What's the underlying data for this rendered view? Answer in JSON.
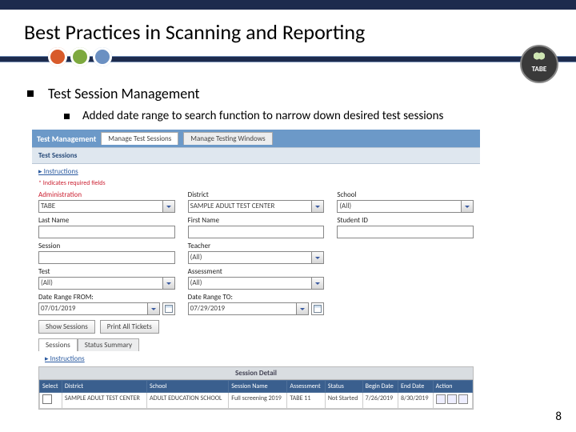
{
  "slide": {
    "title": "Best Practices in Scanning and Reporting",
    "logo_text": "TABE",
    "page_number": "8"
  },
  "bullets": {
    "l1": "Test Session Management",
    "l2": "Added date range to search function to narrow down desired test sessions"
  },
  "app": {
    "nav_title": "Test Management",
    "tab1": "Manage Test Sessions",
    "tab2": "Manage Testing Windows",
    "section_title": "Test Sessions",
    "instructions": "Instructions",
    "required_note": "* Indicates required fields",
    "fields": {
      "admin_label": "Administration",
      "admin_value": "TABE",
      "district_label": "District",
      "district_value": "SAMPLE ADULT TEST CENTER",
      "school_label": "School",
      "school_value": "(All)",
      "lastname_label": "Last Name",
      "firstname_label": "First Name",
      "studentid_label": "Student ID",
      "session_label": "Session",
      "teacher_label": "Teacher",
      "teacher_value": "(All)",
      "test_label": "Test",
      "test_value": "(All)",
      "assessment_label": "Assessment",
      "assessment_value": "(All)",
      "from_label": "Date Range FROM:",
      "from_value": "07/01/2019",
      "to_label": "Date Range TO:",
      "to_value": "07/29/2019"
    },
    "buttons": {
      "show": "Show Sessions",
      "print": "Print All Tickets"
    },
    "result_tabs": {
      "sessions": "Sessions",
      "status": "Status Summary"
    },
    "detail": {
      "title": "Session Detail",
      "cols": {
        "select": "Select",
        "district": "District",
        "school": "School",
        "session_name": "Session Name",
        "assessment": "Assessment",
        "status": "Status",
        "begin": "Begin Date",
        "end": "End Date",
        "action": "Action"
      },
      "row": {
        "district": "SAMPLE ADULT TEST CENTER",
        "school": "ADULT EDUCATION SCHOOL",
        "session_name": "Full screening 2019",
        "assessment": "TABE 11",
        "status": "Not Started",
        "begin": "7/26/2019",
        "end": "8/30/2019"
      }
    }
  }
}
